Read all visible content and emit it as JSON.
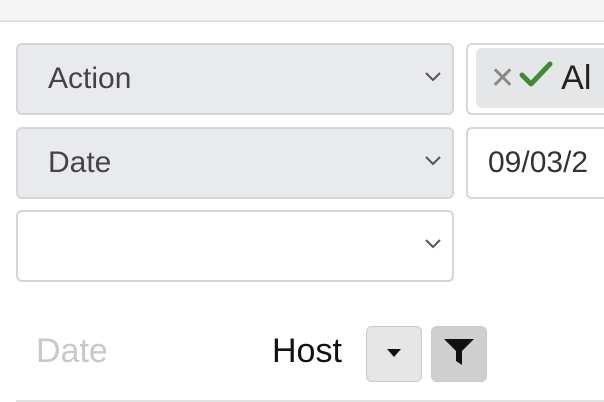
{
  "filters": {
    "action_select": {
      "value": "Action"
    },
    "date_select": {
      "value": "Date"
    },
    "empty_select": {
      "value": ""
    },
    "action_values_chip": {
      "label": "Al"
    },
    "date_input": {
      "value": "09/03/2"
    }
  },
  "table": {
    "header": {
      "date_label": "Date",
      "host_label": "Host"
    }
  },
  "colors": {
    "check_green": "#3c8d2f",
    "select_bg": "#e8eaed"
  }
}
